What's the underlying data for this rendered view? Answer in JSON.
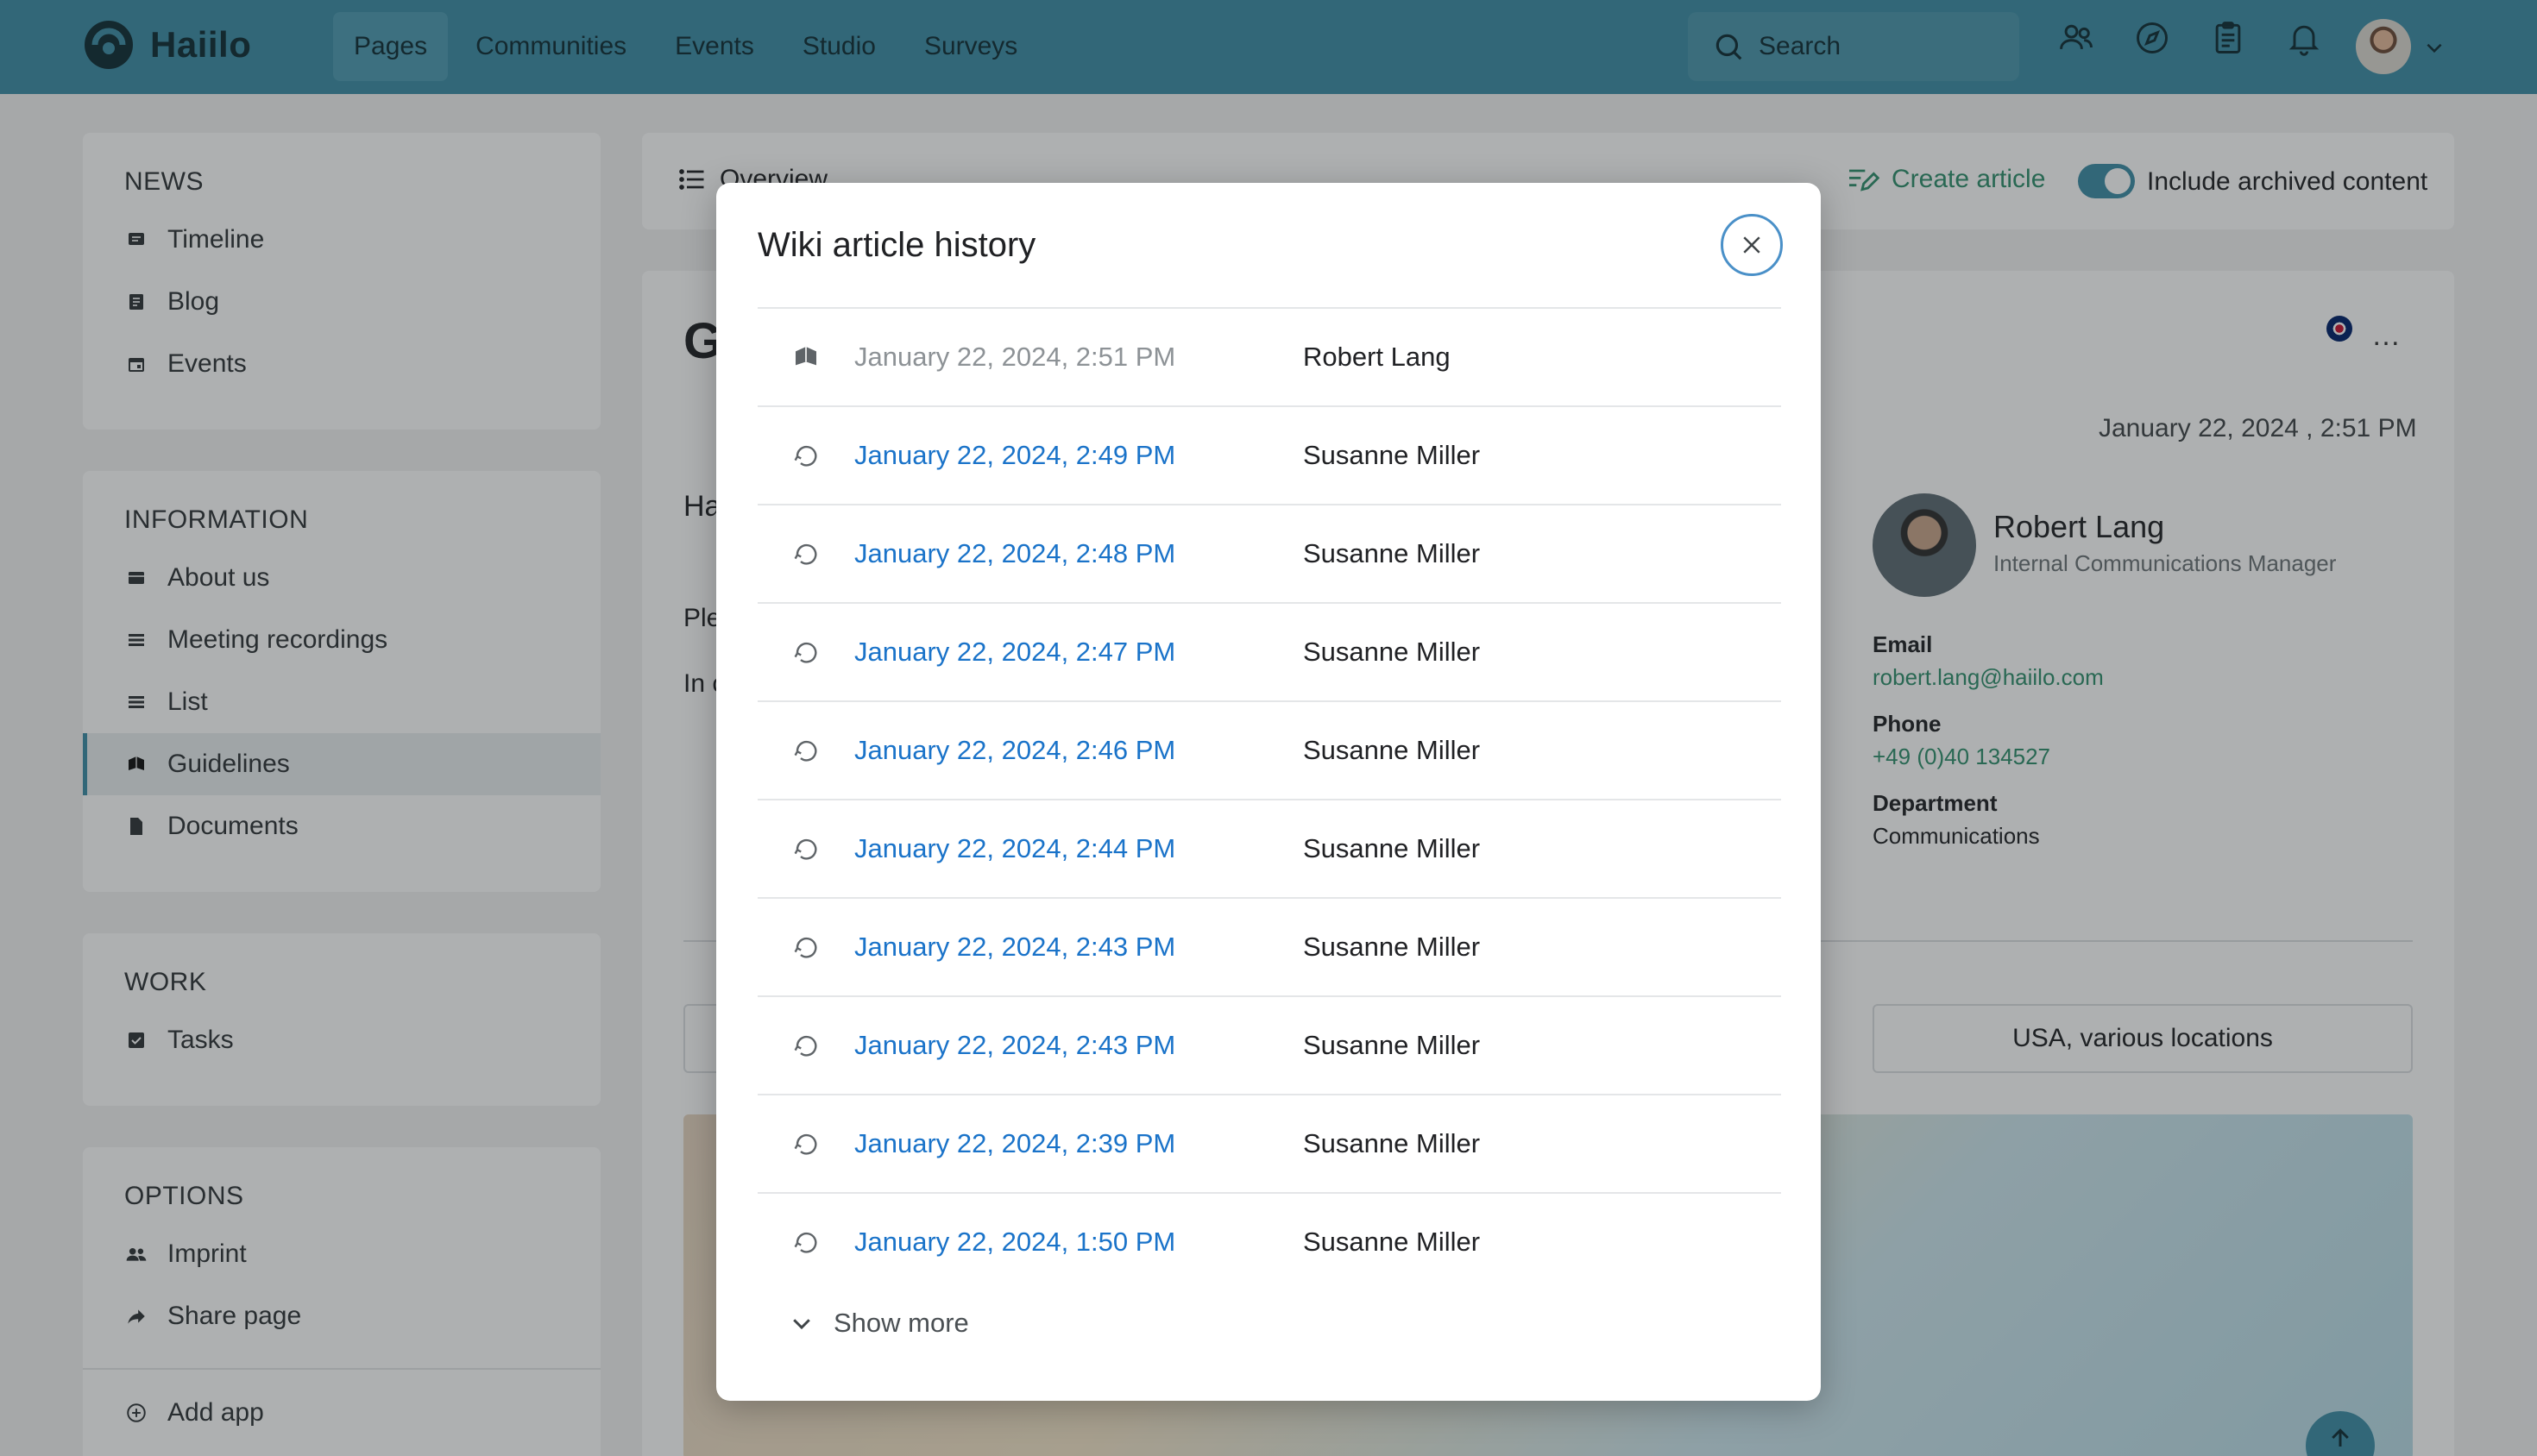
{
  "app": {
    "brand": "Haiilo",
    "nav": [
      {
        "label": "Pages",
        "active": true
      },
      {
        "label": "Communities",
        "active": false
      },
      {
        "label": "Events",
        "active": false
      },
      {
        "label": "Studio",
        "active": false
      },
      {
        "label": "Surveys",
        "active": false
      }
    ],
    "search_label": "Search",
    "icons": [
      "people-icon",
      "compass-icon",
      "clipboard-icon",
      "bell-icon"
    ]
  },
  "sidebar": {
    "news": {
      "heading": "NEWS",
      "items": [
        {
          "label": "Timeline",
          "icon": "timeline-icon"
        },
        {
          "label": "Blog",
          "icon": "blog-icon"
        },
        {
          "label": "Events",
          "icon": "calendar-icon"
        }
      ]
    },
    "information": {
      "heading": "INFORMATION",
      "items": [
        {
          "label": "About us",
          "icon": "card-icon"
        },
        {
          "label": "Meeting recordings",
          "icon": "list-icon"
        },
        {
          "label": "List",
          "icon": "list-icon"
        },
        {
          "label": "Guidelines",
          "icon": "book-icon",
          "active": true
        },
        {
          "label": "Documents",
          "icon": "document-icon"
        }
      ]
    },
    "work": {
      "heading": "WORK",
      "items": [
        {
          "label": "Tasks",
          "icon": "checkbox-icon"
        }
      ]
    },
    "options": {
      "heading": "OPTIONS",
      "items": [
        {
          "label": "Imprint",
          "icon": "people-icon"
        },
        {
          "label": "Share page",
          "icon": "share-icon"
        }
      ],
      "add_app": "Add app"
    }
  },
  "main": {
    "toolbar": {
      "overview": "Overview",
      "create_article": "Create article",
      "include_archived": "Include archived content",
      "include_archived_on": true
    },
    "article": {
      "title_fragment": "G",
      "heading_fragment": "Ha",
      "para1_fragment": "Ple",
      "para2_fragment": "In c",
      "date": "January 22, 2024 , 2:51 PM",
      "author": {
        "name": "Robert Lang",
        "role": "Internal Communications Manager",
        "email_label": "Email",
        "email": "robert.lang@haiilo.com",
        "phone_label": "Phone",
        "phone": "+49 (0)40 134527",
        "department_label": "Department",
        "department": "Communications"
      },
      "location": "USA, various locations"
    }
  },
  "modal": {
    "title": "Wiki article history",
    "rows": [
      {
        "date": "January 22, 2024, 2:51 PM",
        "author": "Robert Lang",
        "current": true
      },
      {
        "date": "January 22, 2024, 2:49 PM",
        "author": "Susanne Miller",
        "current": false
      },
      {
        "date": "January 22, 2024, 2:48 PM",
        "author": "Susanne Miller",
        "current": false
      },
      {
        "date": "January 22, 2024, 2:47 PM",
        "author": "Susanne Miller",
        "current": false
      },
      {
        "date": "January 22, 2024, 2:46 PM",
        "author": "Susanne Miller",
        "current": false
      },
      {
        "date": "January 22, 2024, 2:44 PM",
        "author": "Susanne Miller",
        "current": false
      },
      {
        "date": "January 22, 2024, 2:43 PM",
        "author": "Susanne Miller",
        "current": false
      },
      {
        "date": "January 22, 2024, 2:43 PM",
        "author": "Susanne Miller",
        "current": false
      },
      {
        "date": "January 22, 2024, 2:39 PM",
        "author": "Susanne Miller",
        "current": false
      },
      {
        "date": "January 22, 2024, 1:50 PM",
        "author": "Susanne Miller",
        "current": false
      }
    ],
    "show_more": "Show more"
  },
  "colors": {
    "topbar": "#3d8ea6",
    "link_blue": "#1a73c9",
    "accent_green": "#2f8f6d",
    "close_ring": "#4a90c8"
  }
}
